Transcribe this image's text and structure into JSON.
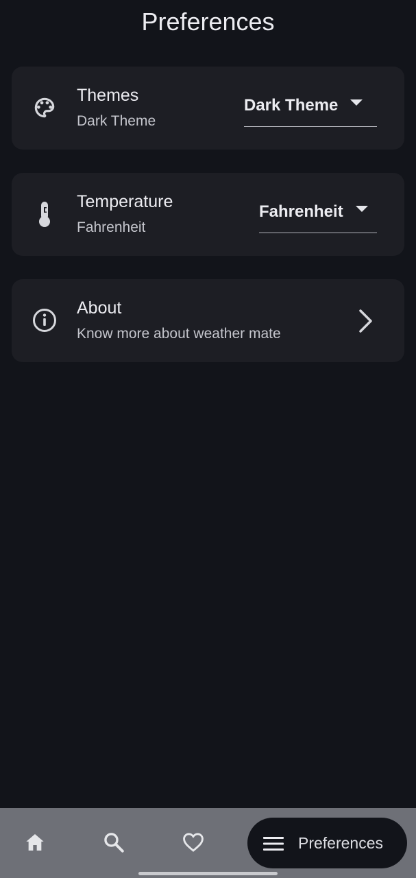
{
  "header": {
    "title": "Preferences"
  },
  "settings": {
    "themes": {
      "icon": "palette-icon",
      "label": "Themes",
      "subtitle": "Dark Theme",
      "dropdown_value": "Dark Theme"
    },
    "temperature": {
      "icon": "thermometer-icon",
      "label": "Temperature",
      "subtitle": "Fahrenheit",
      "dropdown_value": "Fahrenheit"
    },
    "about": {
      "icon": "info-icon",
      "label": "About",
      "subtitle": "Know more about weather mate"
    }
  },
  "bottom_nav": {
    "items": [
      {
        "icon": "home-icon"
      },
      {
        "icon": "search-icon"
      },
      {
        "icon": "heart-icon"
      },
      {
        "icon": "menu-icon",
        "label": "Preferences",
        "active": true
      }
    ]
  },
  "colors": {
    "background": "#12141a",
    "card": "#1d1e24",
    "nav_bar": "#6e7077",
    "text": "#ececf1"
  }
}
